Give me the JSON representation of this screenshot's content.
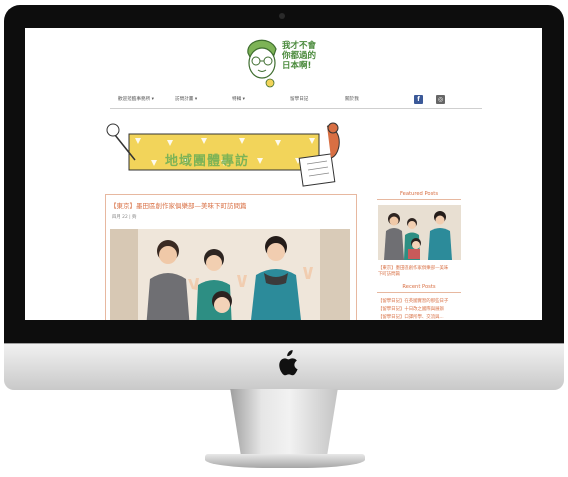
{
  "logo": {
    "line1": "我才不會",
    "line2": "你都過的",
    "line3": "日本啊!"
  },
  "nav": {
    "items": [
      {
        "label": "歡迎蒞臨事務所 ▾"
      },
      {
        "label": "訪問計畫 ▾"
      },
      {
        "label": "特輯 ▾"
      },
      {
        "label": "留學日記"
      },
      {
        "label": "關於我"
      }
    ],
    "social": [
      {
        "icon": "facebook-icon",
        "glyph": "f",
        "color": "#3b5998"
      },
      {
        "icon": "instagram-icon",
        "glyph": "◎",
        "color": "#555555"
      }
    ]
  },
  "banner": {
    "text": "地域團體專訪"
  },
  "post": {
    "title": "【東京】墨田區創作家俱樂部—美味下町訪問篇",
    "meta": "四月 22 | 夠"
  },
  "sidebar": {
    "featured_heading": "Featured Posts",
    "featured_caption_1": "【東京】墨田區創作家俱樂部—美味",
    "featured_caption_2": "下町訪問篇",
    "recent_heading": "Recent Posts",
    "recent": [
      {
        "label": "【留學日記】在英國實習的那些日子"
      },
      {
        "label": "【留學日記】十日改之國際與展辦"
      },
      {
        "label": "【留學日記】口譯所學、交流與..."
      }
    ]
  },
  "colors": {
    "accent": "#d86f43",
    "logo_green": "#4a8a3c",
    "banner_yellow": "#f2d45a"
  }
}
